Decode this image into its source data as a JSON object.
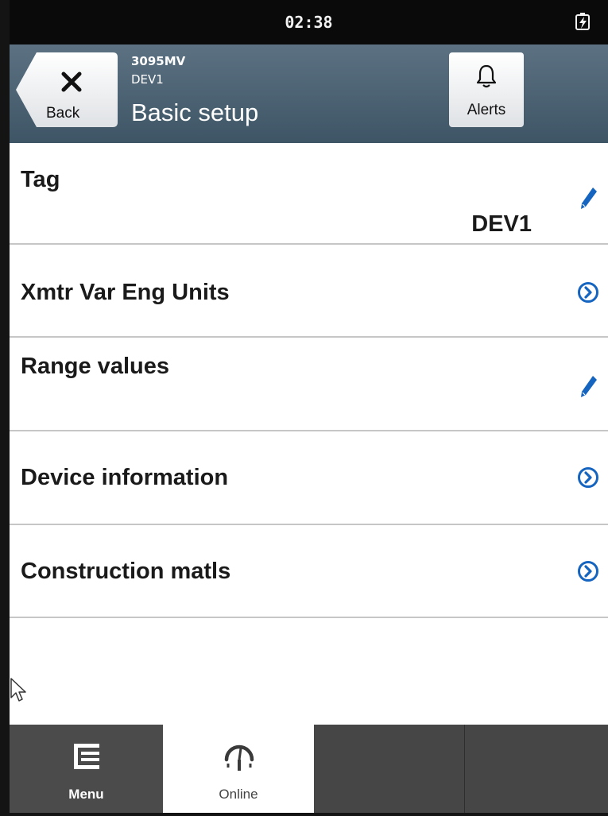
{
  "status_bar": {
    "time": "02:38",
    "battery_icon": "battery-charging-icon"
  },
  "header": {
    "back_label": "Back",
    "back_icon": "close-icon",
    "device_model": "3095MV",
    "device_tag": "DEV1",
    "title": "Basic setup",
    "alerts_label": "Alerts",
    "alerts_icon": "bell-icon",
    "colors": {
      "header_top": "#5c7283",
      "header_bottom": "#3e5566"
    }
  },
  "list": {
    "items": [
      {
        "label": "Tag",
        "value": "DEV1",
        "action_icon": "pencil-icon"
      },
      {
        "label": "Xmtr Var Eng Units",
        "action_icon": "chevron-right-circle-icon"
      },
      {
        "label": "Range values",
        "action_icon": "pencil-icon"
      },
      {
        "label": "Device information",
        "action_icon": "chevron-right-circle-icon"
      },
      {
        "label": "Construction matls",
        "action_icon": "chevron-right-circle-icon"
      }
    ],
    "accent_color": "#1565c0"
  },
  "bottom_nav": {
    "items": [
      {
        "label": "Menu",
        "icon": "menu-list-icon",
        "active": false
      },
      {
        "label": "Online",
        "icon": "gauge-online-icon",
        "active": true
      }
    ]
  }
}
